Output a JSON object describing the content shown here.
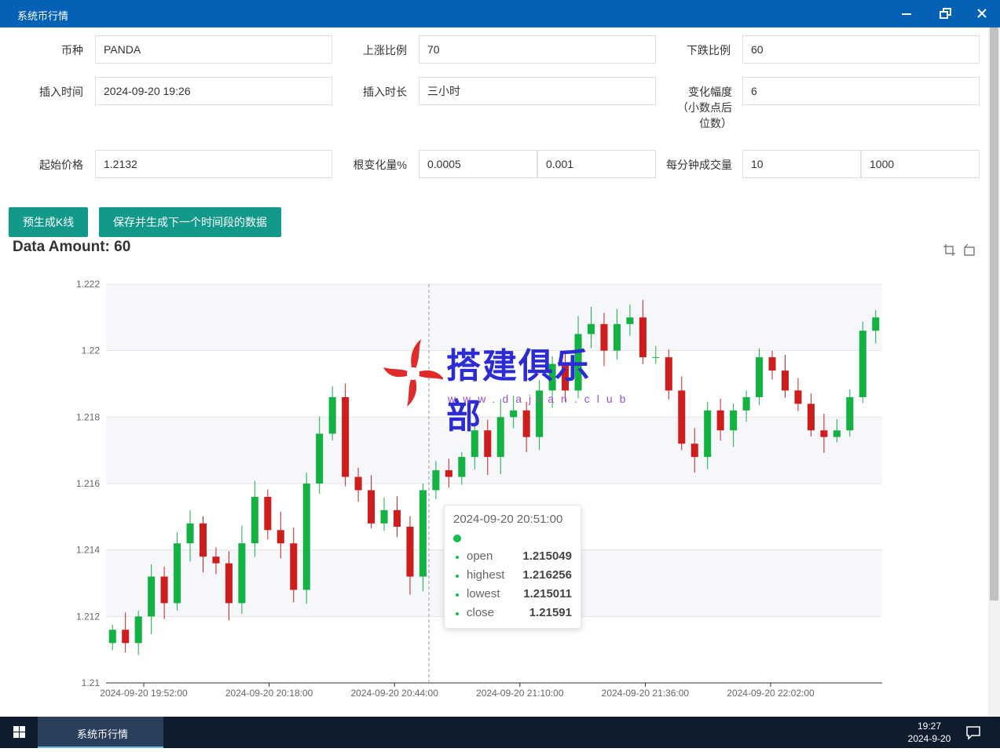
{
  "window": {
    "title": "系统币行情"
  },
  "form": {
    "coin_label": "币种",
    "coin_value": "PANDA",
    "up_ratio_label": "上涨比例",
    "up_ratio_value": "70",
    "down_ratio_label": "下跌比例",
    "down_ratio_value": "60",
    "insert_time_label": "插入时间",
    "insert_time_value": "2024-09-20 19:26",
    "insert_duration_label": "插入时长",
    "insert_duration_value": "三小时",
    "change_range_label": "变化幅度（小数点后位数）",
    "change_range_value": "6",
    "start_price_label": "起始价格",
    "start_price_value": "1.2132",
    "root_change_label": "根变化量%",
    "root_change_min": "0.0005",
    "root_change_max": "0.001",
    "volume_label": "每分钟成交量",
    "volume_min": "10",
    "volume_max": "1000"
  },
  "buttons": {
    "pregen": "预生成K线",
    "save_next": "保存并生成下一个时间段的数据"
  },
  "chart_header": {
    "amount_text": "Data Amount: 60"
  },
  "toolbox": {
    "icons": [
      "zoom-icon",
      "zoom-reset-icon"
    ]
  },
  "chart_data": {
    "type": "candlestick",
    "count": 60,
    "ylim": [
      1.21,
      1.222
    ],
    "y_ticks": [
      "1.21",
      "1.212",
      "1.214",
      "1.216",
      "1.218",
      "1.22",
      "1.222"
    ],
    "x_tick_labels": [
      "2024-09-20 19:52:00",
      "2024-09-20 20:18:00",
      "2024-09-20 20:44:00",
      "2024-09-20 21:10:00",
      "2024-09-20 21:36:00",
      "2024-09-20 22:02:00"
    ],
    "grid": true,
    "up_color": "#14b143",
    "down_color": "#ce1d1d",
    "price_path": [
      1.2116,
      1.2112,
      1.212,
      1.2132,
      1.2124,
      1.2142,
      1.2148,
      1.2138,
      1.2136,
      1.2124,
      1.2142,
      1.2156,
      1.2146,
      1.2142,
      1.2128,
      1.216,
      1.2175,
      1.2186,
      1.2162,
      1.2158,
      1.2148,
      1.2152,
      1.2147,
      1.2132,
      1.2158,
      1.2164,
      1.2162,
      1.2168,
      1.2176,
      1.2168,
      1.218,
      1.2182,
      1.2174,
      1.2188,
      1.2196,
      1.2188,
      1.2205,
      1.2208,
      1.22,
      1.2208,
      1.221,
      1.2198,
      1.2198,
      1.2188,
      1.2172,
      1.2168,
      1.2182,
      1.2176,
      1.2182,
      1.2186,
      1.2198,
      1.2194,
      1.2188,
      1.2184,
      1.2176,
      1.2174,
      1.2176,
      1.2186,
      1.2206,
      1.221
    ]
  },
  "tooltip": {
    "time": "2024-09-20 20:51:00",
    "marker_color": "#14c04c",
    "rows": [
      {
        "key": "open",
        "value": "1.215049"
      },
      {
        "key": "highest",
        "value": "1.216256"
      },
      {
        "key": "lowest",
        "value": "1.215011"
      },
      {
        "key": "close",
        "value": "1.21591"
      }
    ]
  },
  "watermark": {
    "text": "搭建俱乐部",
    "url": "www.dajian.club"
  },
  "taskbar": {
    "app_label": "系统币行情",
    "time": "19:27",
    "date": "2024-9-20"
  }
}
